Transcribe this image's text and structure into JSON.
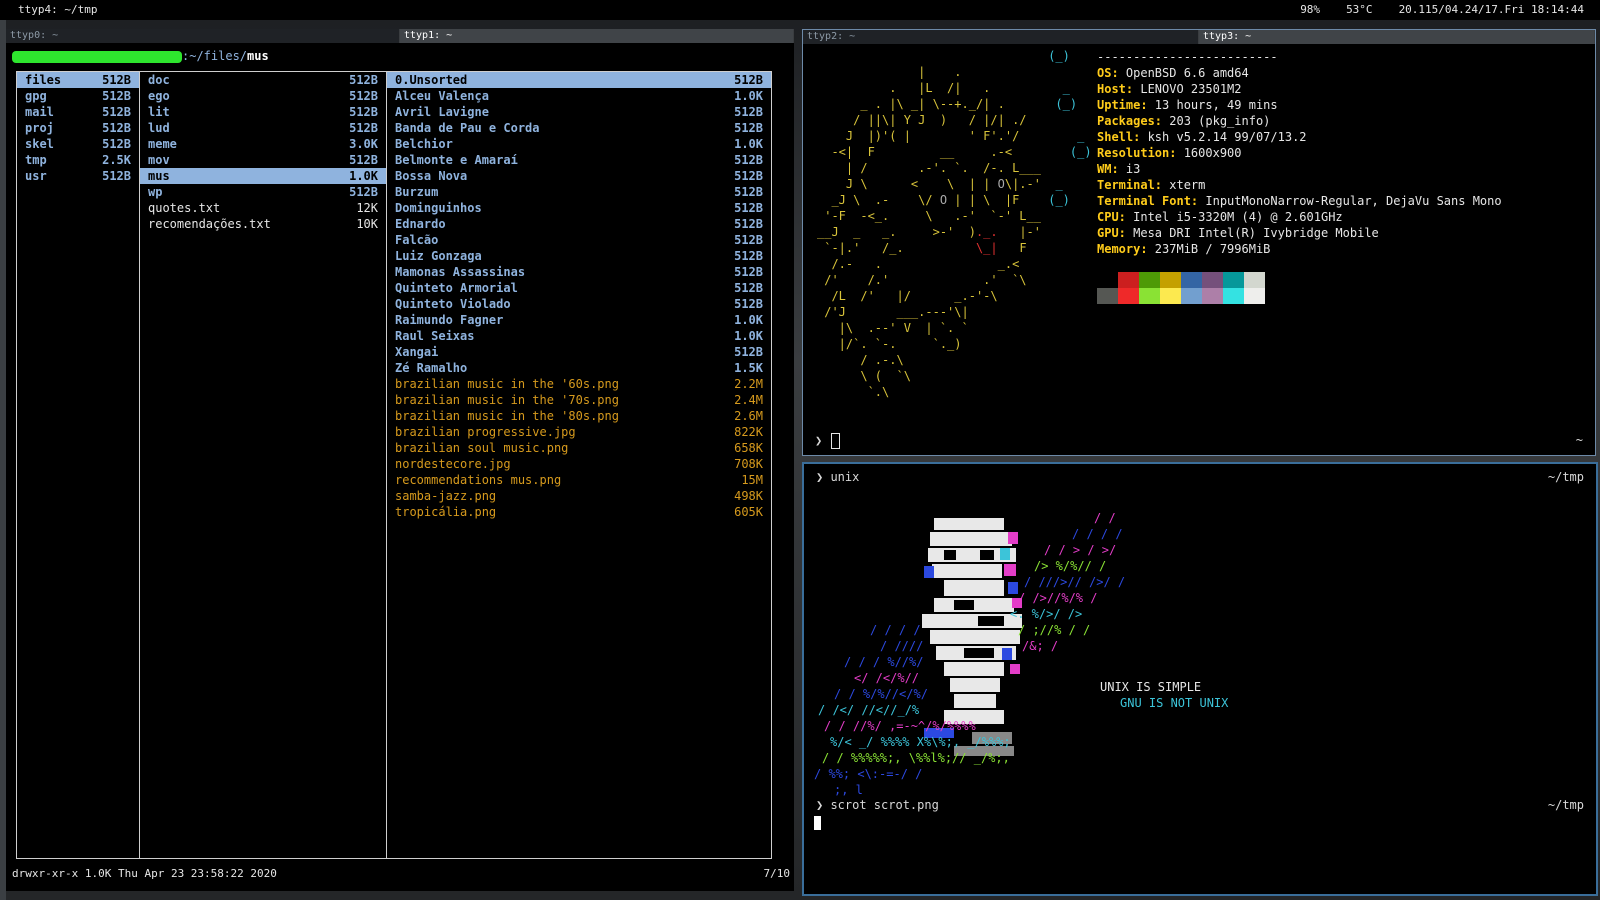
{
  "topbar": {
    "title": "ttyp4: ~/tmp",
    "battery": "98%",
    "temp": "53°C",
    "datetime": "20.115/04.24/17.Fri 18:14:44"
  },
  "tabs_left": [
    {
      "label": "ttyp0: ~",
      "active": false
    },
    {
      "label": "ttyp1: ~",
      "active": true
    }
  ],
  "tabs_right": [
    {
      "label": "ttyp2: ~",
      "active": false
    },
    {
      "label": "ttyp3: ~",
      "active": true
    }
  ],
  "ranger": {
    "path_suffix": ":~/files/",
    "path_current": "mus",
    "col1": [
      {
        "name": "files",
        "size": "512B",
        "type": "dir",
        "selected": true
      },
      {
        "name": "gpg",
        "size": "512B",
        "type": "dir"
      },
      {
        "name": "mail",
        "size": "512B",
        "type": "dir"
      },
      {
        "name": "proj",
        "size": "512B",
        "type": "dir"
      },
      {
        "name": "skel",
        "size": "512B",
        "type": "dir"
      },
      {
        "name": "tmp",
        "size": "2.5K",
        "type": "dir"
      },
      {
        "name": "usr",
        "size": "512B",
        "type": "dir"
      }
    ],
    "col2": [
      {
        "name": "doc",
        "size": "512B",
        "type": "dir"
      },
      {
        "name": "ego",
        "size": "512B",
        "type": "dir"
      },
      {
        "name": "lit",
        "size": "512B",
        "type": "dir"
      },
      {
        "name": "lud",
        "size": "512B",
        "type": "dir"
      },
      {
        "name": "meme",
        "size": "3.0K",
        "type": "dir"
      },
      {
        "name": "mov",
        "size": "512B",
        "type": "dir"
      },
      {
        "name": "mus",
        "size": "1.0K",
        "type": "dir",
        "selected": true
      },
      {
        "name": "wp",
        "size": "512B",
        "type": "dir"
      },
      {
        "name": "quotes.txt",
        "size": "12K",
        "type": "file"
      },
      {
        "name": "recomendações.txt",
        "size": "10K",
        "type": "file"
      }
    ],
    "col3": [
      {
        "name": "0.Unsorted",
        "size": "512B",
        "type": "dir",
        "selected": true
      },
      {
        "name": "Alceu Valença",
        "size": "1.0K",
        "type": "dir"
      },
      {
        "name": "Avril Lavigne",
        "size": "512B",
        "type": "dir"
      },
      {
        "name": "Banda de Pau e Corda",
        "size": "512B",
        "type": "dir"
      },
      {
        "name": "Belchior",
        "size": "1.0K",
        "type": "dir"
      },
      {
        "name": "Belmonte e Amaraí",
        "size": "512B",
        "type": "dir"
      },
      {
        "name": "Bossa Nova",
        "size": "512B",
        "type": "dir"
      },
      {
        "name": "Burzum",
        "size": "512B",
        "type": "dir"
      },
      {
        "name": "Dominguinhos",
        "size": "512B",
        "type": "dir"
      },
      {
        "name": "Ednardo",
        "size": "512B",
        "type": "dir"
      },
      {
        "name": "Falcão",
        "size": "512B",
        "type": "dir"
      },
      {
        "name": "Luiz Gonzaga",
        "size": "512B",
        "type": "dir"
      },
      {
        "name": "Mamonas Assassinas",
        "size": "512B",
        "type": "dir"
      },
      {
        "name": "Quinteto Armorial",
        "size": "512B",
        "type": "dir"
      },
      {
        "name": "Quinteto Violado",
        "size": "512B",
        "type": "dir"
      },
      {
        "name": "Raimundo Fagner",
        "size": "1.0K",
        "type": "dir"
      },
      {
        "name": "Raul Seixas",
        "size": "1.0K",
        "type": "dir"
      },
      {
        "name": "Xangai",
        "size": "512B",
        "type": "dir"
      },
      {
        "name": "Zé Ramalho",
        "size": "1.5K",
        "type": "dir"
      },
      {
        "name": "brazilian music in the '60s.png",
        "size": "2.2M",
        "type": "img"
      },
      {
        "name": "brazilian music in the '70s.png",
        "size": "2.4M",
        "type": "img"
      },
      {
        "name": "brazilian music in the '80s.png",
        "size": "2.6M",
        "type": "img"
      },
      {
        "name": "brazilian progressive.jpg",
        "size": "822K",
        "type": "img"
      },
      {
        "name": "brazilian soul music.png",
        "size": "658K",
        "type": "img"
      },
      {
        "name": "nordestecore.jpg",
        "size": "708K",
        "type": "img"
      },
      {
        "name": "recommendations mus.png",
        "size": "15M",
        "type": "img"
      },
      {
        "name": "samba-jazz.png",
        "size": "498K",
        "type": "img"
      },
      {
        "name": "tropicália.png",
        "size": "605K",
        "type": "img"
      }
    ],
    "status": "drwxr-xr-x 1.0K Thu Apr 23 23:58:22 2020",
    "position": "7/10"
  },
  "neofetch": {
    "header": "-------------------------",
    "info": [
      {
        "key": "OS:",
        "value": " OpenBSD 6.6 amd64"
      },
      {
        "key": "Host:",
        "value": " LENOVO 23501M2"
      },
      {
        "key": "Uptime:",
        "value": " 13 hours, 49 mins"
      },
      {
        "key": "Packages:",
        "value": " 203 (pkg_info)"
      },
      {
        "key": "Shell:",
        "value": " ksh v5.2.14 99/07/13.2"
      },
      {
        "key": "Resolution:",
        "value": " 1600x900"
      },
      {
        "key": "WM:",
        "value": " i3"
      },
      {
        "key": "Terminal:",
        "value": " xterm"
      },
      {
        "key": "Terminal Font:",
        "value": " InputMonoNarrow-Regular, DejaVu Sans Mono"
      },
      {
        "key": "CPU:",
        "value": " Intel i5-3320M (4) @ 2.601GHz"
      },
      {
        "key": "GPU:",
        "value": " Mesa DRI Intel(R) Ivybridge Mobile"
      },
      {
        "key": "Memory:",
        "value": " 237MiB / 7996MiB"
      }
    ],
    "palette": [
      "#000000",
      "#cc1f1f",
      "#4e9a06",
      "#c4a000",
      "#3465a4",
      "#75507b",
      "#06989a",
      "#d3d7cf",
      "#555753",
      "#ef2929",
      "#8ae234",
      "#fce94f",
      "#729fcf",
      "#ad7fa8",
      "#34e2e2",
      "#eeeeec"
    ],
    "prompt": "❯",
    "cwd": "~"
  },
  "unix": {
    "prompt1": "❯ unix",
    "cwd1": "~/tmp",
    "line1": "UNIX IS SIMPLE",
    "line2": "GNU IS NOT UNIX",
    "prompt2": "❯ scrot scrot.png",
    "cwd2": "~/tmp"
  }
}
